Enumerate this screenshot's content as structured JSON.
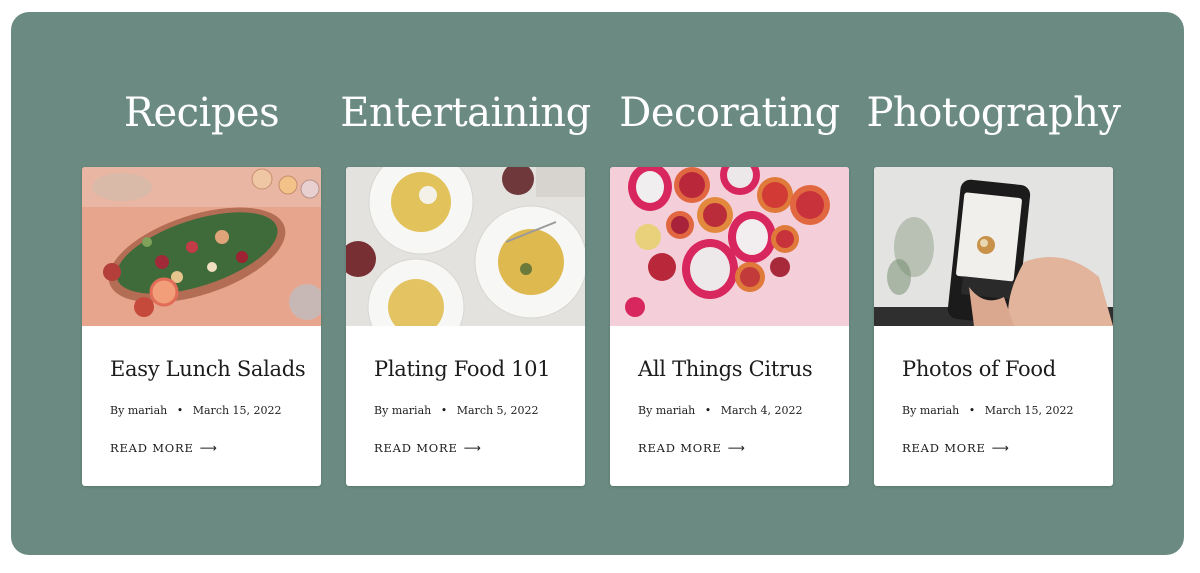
{
  "columns": [
    {
      "category": "Recipes",
      "post": {
        "title": "Easy Lunch Salads",
        "author_prefix": "By",
        "author": "mariah",
        "date": "March 15, 2022",
        "read_more": "READ MORE",
        "image": "salad-platter-photo"
      }
    },
    {
      "category": "Entertaining",
      "post": {
        "title": "Plating Food 101",
        "author_prefix": "By",
        "author": "mariah",
        "date": "March 5, 2022",
        "read_more": "READ MORE",
        "image": "pasta-plates-photo"
      }
    },
    {
      "category": "Decorating",
      "post": {
        "title": "All Things Citrus",
        "author_prefix": "By",
        "author": "mariah",
        "date": "March 4, 2022",
        "read_more": "READ MORE",
        "image": "citrus-dragonfruit-photo"
      }
    },
    {
      "category": "Photography",
      "post": {
        "title": "Photos of Food",
        "author_prefix": "By",
        "author": "mariah",
        "date": "March 15, 2022",
        "read_more": "READ MORE",
        "image": "phone-photographing-food-photo"
      }
    }
  ],
  "colors": {
    "panel": "#6b8b82",
    "card": "#ffffff",
    "text": "#1c1c1c"
  },
  "icons": {
    "read_more": "arrow-right-icon",
    "separator": "bullet-dot"
  }
}
